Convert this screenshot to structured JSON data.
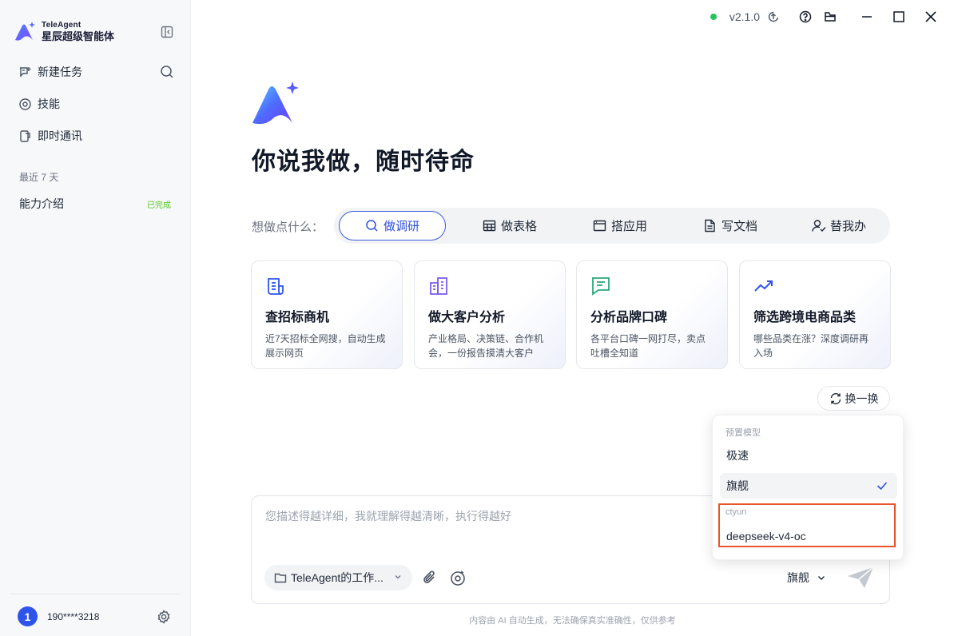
{
  "brand": {
    "name_en": "TeleAgent",
    "name_cn": "星辰超级智能体"
  },
  "sidebar": {
    "items": [
      {
        "label": "新建任务",
        "icon": "new-chat-icon"
      },
      {
        "label": "技能",
        "icon": "skill-icon"
      },
      {
        "label": "即时通讯",
        "icon": "chat-device-icon"
      }
    ],
    "section_label": "最近 7 天",
    "history": [
      {
        "title": "能力介绍",
        "status": "已完成"
      }
    ],
    "user": {
      "avatar_text": "1",
      "phone": "190****3218"
    }
  },
  "topbar": {
    "version": "v2.1.0"
  },
  "main": {
    "hero_title": "你说我做，随时待命",
    "ask_label": "想做点什么：",
    "tabs": [
      {
        "label": "做调研",
        "icon": "search-icon",
        "active": true
      },
      {
        "label": "做表格",
        "icon": "table-icon",
        "active": false
      },
      {
        "label": "搭应用",
        "icon": "app-window-icon",
        "active": false
      },
      {
        "label": "写文档",
        "icon": "document-icon",
        "active": false
      },
      {
        "label": "替我办",
        "icon": "user-check-icon",
        "active": false
      }
    ],
    "cards": [
      {
        "title": "查招标商机",
        "desc": "近7天招标全网搜，自动生成展示网页",
        "icon": "scroll-icon",
        "color": "#2f54eb"
      },
      {
        "title": "做大客户分析",
        "desc": "产业格局、决策链、合作机会，一份报告摸清大客户",
        "icon": "building-icon",
        "color": "#7c5cf0"
      },
      {
        "title": "分析品牌口碑",
        "desc": "各平台口碑一网打尽，卖点吐槽全知道",
        "icon": "message-icon",
        "color": "#2aa87a"
      },
      {
        "title": "筛选跨境电商品类",
        "desc": "哪些品类在涨？深度调研再入场",
        "icon": "trend-up-icon",
        "color": "#2f54eb"
      }
    ],
    "refresh_label": "换一换"
  },
  "input": {
    "placeholder": "您描述得越详细，我就理解得越清晰，执行得越好",
    "workspace": "TeleAgent的工作...",
    "model_selected": "旗舰"
  },
  "dropdown": {
    "group1_label": "预置模型",
    "group1_items": [
      "极速",
      "旗舰"
    ],
    "selected": "旗舰",
    "group2_label": "ctyun",
    "group2_items": [
      "deepseek-v4-oc"
    ]
  },
  "footer_note": "内容由 AI 自动生成，无法确保真实准确性，仅供参考",
  "colors": {
    "accent": "#2f4fd8",
    "success": "#52c41a",
    "highlight": "#e8552d"
  }
}
